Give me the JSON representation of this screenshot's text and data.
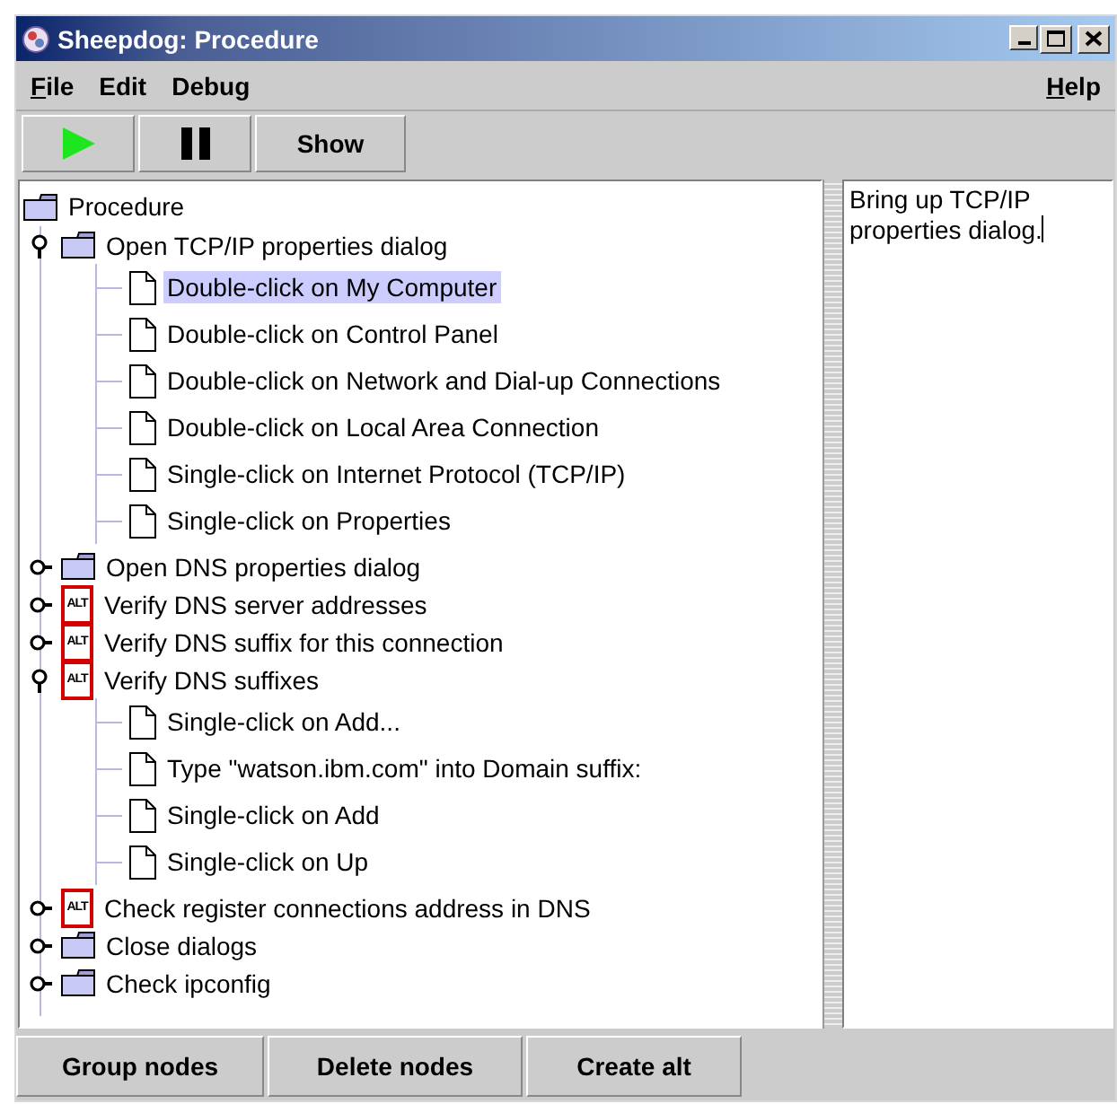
{
  "window": {
    "title": "Sheepdog: Procedure"
  },
  "menu": [
    {
      "label": "File",
      "mnemonic": true
    },
    {
      "label": "Edit",
      "mnemonic": false
    },
    {
      "label": "Debug",
      "mnemonic": false
    },
    {
      "label": "Help",
      "mnemonic": true
    }
  ],
  "toolbar": [
    {
      "kind": "play"
    },
    {
      "kind": "pause"
    },
    {
      "kind": "text",
      "label": "Show"
    }
  ],
  "tree": {
    "root": "Procedure",
    "items": [
      {
        "label": "Open TCP/IP properties dialog",
        "kind": "folder",
        "expanded": true,
        "selected": false,
        "children": [
          {
            "label": "Double-click on My Computer",
            "kind": "leaf",
            "selected": true
          },
          {
            "label": "Double-click on Control Panel",
            "kind": "leaf",
            "selected": false
          },
          {
            "label": "Double-click on Network and Dial-up Connections",
            "kind": "leaf",
            "selected": false
          },
          {
            "label": "Double-click on Local Area Connection",
            "kind": "leaf",
            "selected": false
          },
          {
            "label": "Single-click on Internet Protocol (TCP/IP)",
            "kind": "leaf",
            "selected": false
          },
          {
            "label": "Single-click on Properties",
            "kind": "leaf",
            "selected": false
          }
        ]
      },
      {
        "label": "Open DNS properties dialog",
        "kind": "folder",
        "expanded": false,
        "selected": false
      },
      {
        "label": "Verify DNS server addresses",
        "kind": "alt",
        "badge": "ALT",
        "expanded": false,
        "selected": false
      },
      {
        "label": "Verify DNS suffix for this connection",
        "kind": "alt",
        "badge": "ALT",
        "expanded": false,
        "selected": false
      },
      {
        "label": "Verify DNS suffixes",
        "kind": "alt",
        "badge": "ALT",
        "expanded": true,
        "selected": false,
        "children": [
          {
            "label": "Single-click on Add...",
            "kind": "leaf",
            "selected": false
          },
          {
            "label": "Type \"watson.ibm.com\" into Domain suffix:",
            "kind": "leaf",
            "selected": false
          },
          {
            "label": "Single-click on Add",
            "kind": "leaf",
            "selected": false
          },
          {
            "label": "Single-click on Up",
            "kind": "leaf",
            "selected": false
          }
        ]
      },
      {
        "label": "Check register connections address in DNS",
        "kind": "alt",
        "badge": "ALT",
        "expanded": false,
        "selected": false
      },
      {
        "label": "Close dialogs",
        "kind": "folder",
        "expanded": false,
        "selected": false
      },
      {
        "label": "Check ipconfig",
        "kind": "folder",
        "expanded": false,
        "selected": false
      }
    ]
  },
  "description": {
    "value": "Bring up TCP/IP properties dialog."
  },
  "buttons": [
    "Group nodes",
    "Delete nodes",
    "Create alt"
  ]
}
